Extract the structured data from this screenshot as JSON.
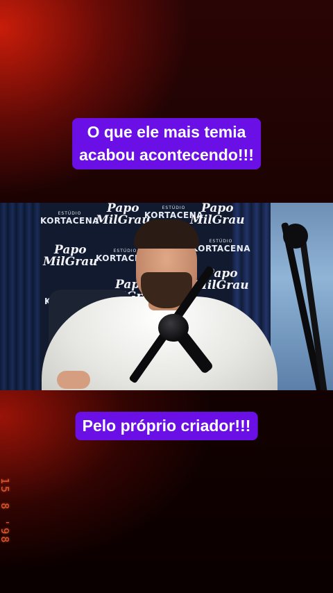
{
  "captions": {
    "top_line1": "O que ele mais temia",
    "top_line2": "acabou acontecendo!!!",
    "bottom": "Pelo próprio criador!!!"
  },
  "video": {
    "backdrop_logos": {
      "studio_small": "ESTÚDIO",
      "studio_big": "KORTACENA",
      "show_line1": "Papo",
      "show_line2": "MilGrau"
    }
  },
  "date_stamp": "15 8 '98",
  "colors": {
    "caption_bg": "#6a10e6",
    "caption_text": "#ffffff",
    "date_stamp": "#e2582e"
  }
}
